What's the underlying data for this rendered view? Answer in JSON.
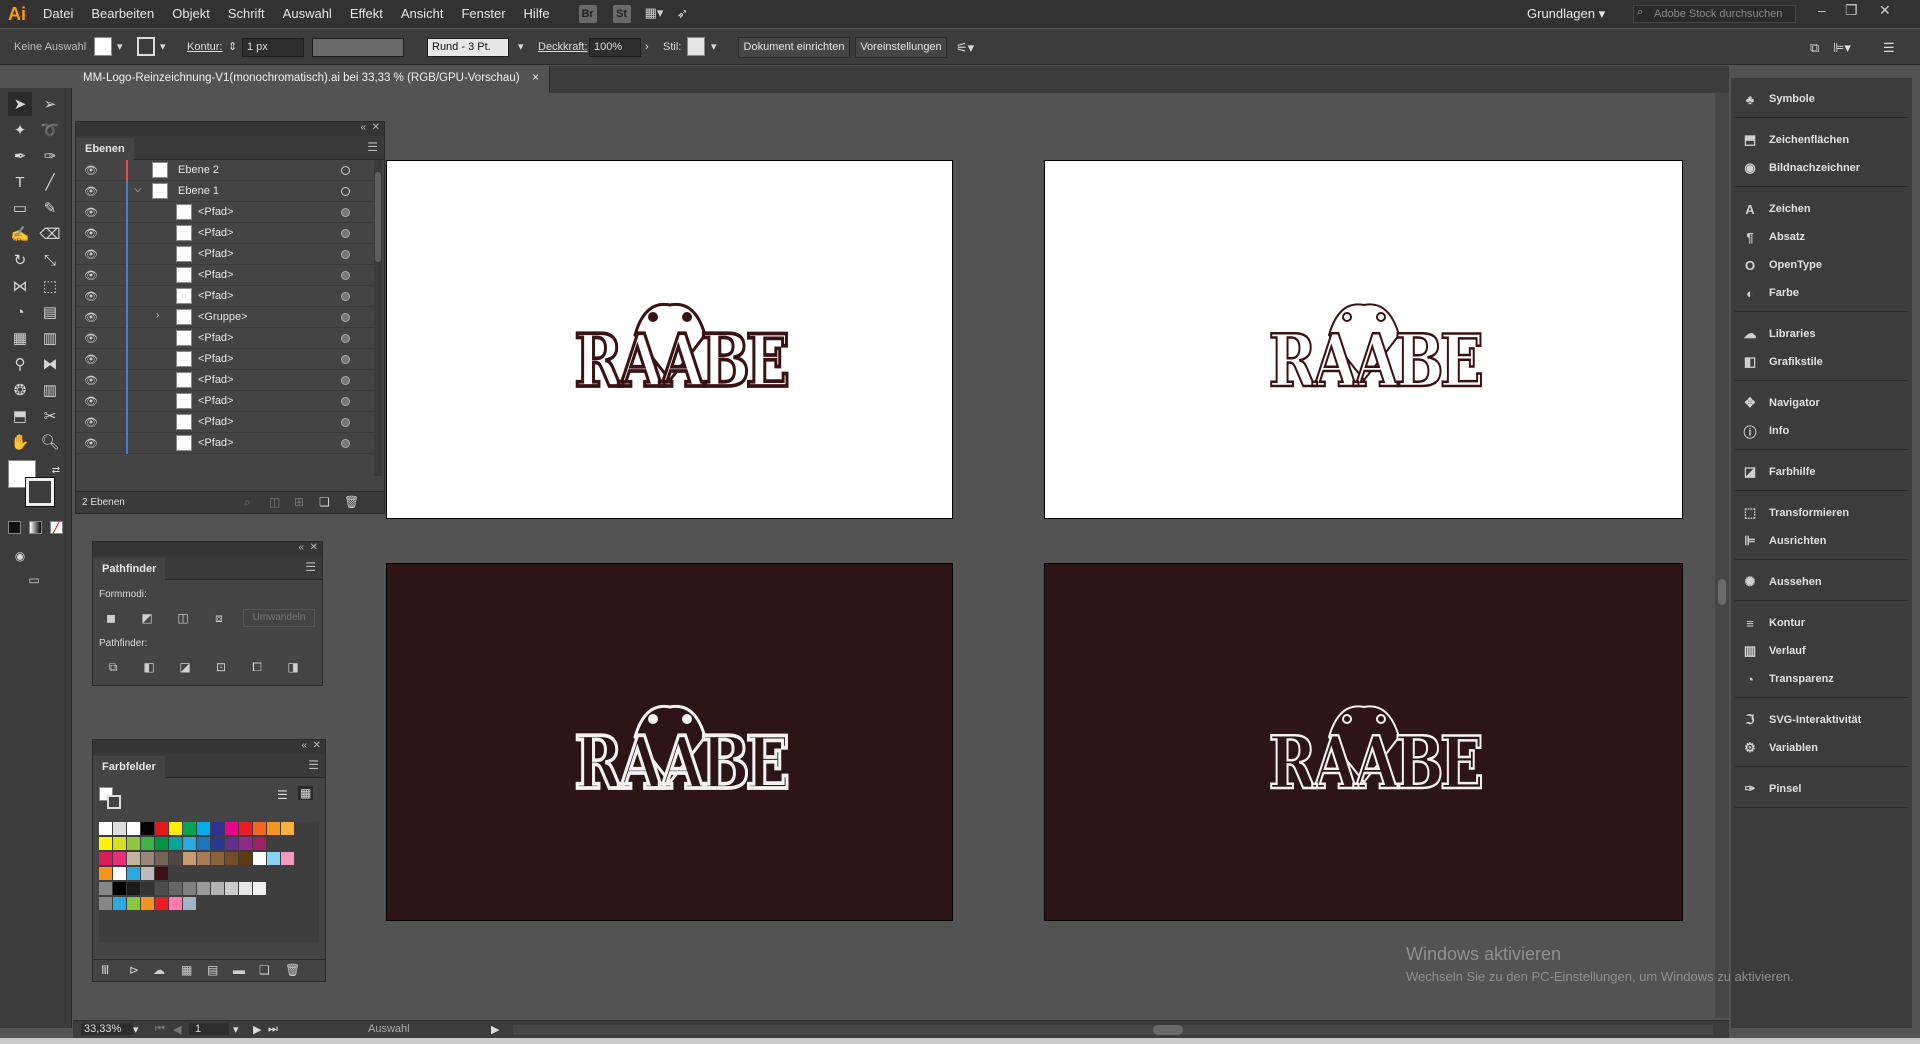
{
  "app": {
    "logo": "Ai"
  },
  "menu": [
    "Datei",
    "Bearbeiten",
    "Objekt",
    "Schrift",
    "Auswahl",
    "Effekt",
    "Ansicht",
    "Fenster",
    "Hilfe"
  ],
  "menubar_icons": {
    "bridge": "Br",
    "stock": "St"
  },
  "workspace": "Grundlagen",
  "stock_search_placeholder": "Adobe Stock durchsuchen",
  "controlbar": {
    "selection": "Keine Auswahl",
    "stroke_label": "Kontur:",
    "stroke_value": "1 px",
    "brush": "Rund - 3 Pt.",
    "opacity_label": "Deckkraft:",
    "opacity_value": "100%",
    "style_label": "Stil:",
    "document_setup": "Dokument einrichten",
    "preferences": "Voreinstellungen"
  },
  "document_tab": {
    "title": "MM-Logo-Reinzeichnung-V1(monochromatisch).ai bei 33,33 % (RGB/GPU-Vorschau)",
    "close": "×"
  },
  "artboards": [
    {
      "bg": "light",
      "logo": "RAABE"
    },
    {
      "bg": "light",
      "logo": "RAABE"
    },
    {
      "bg": "dark",
      "logo": "RAABE"
    },
    {
      "bg": "dark",
      "logo": "RAABE"
    }
  ],
  "layers_panel": {
    "tab": "Ebenen",
    "footer": "2 Ebenen",
    "rows": [
      {
        "name": "Ebene 2",
        "color": "#e8484c"
      },
      {
        "name": "Ebene 1",
        "color": "#3f7fd8"
      },
      {
        "name": "<Pfad>"
      },
      {
        "name": "<Pfad>"
      },
      {
        "name": "<Pfad>"
      },
      {
        "name": "<Pfad>"
      },
      {
        "name": "<Pfad>"
      },
      {
        "name": "<Gruppe>"
      },
      {
        "name": "<Pfad>"
      },
      {
        "name": "<Pfad>"
      },
      {
        "name": "<Pfad>"
      },
      {
        "name": "<Pfad>"
      },
      {
        "name": "<Pfad>"
      },
      {
        "name": "<Pfad>"
      }
    ]
  },
  "pathfinder_panel": {
    "tab": "Pathfinder",
    "shape_modes": "Formmodi:",
    "pathfinders": "Pathfinder:",
    "expand": "Umwandeln"
  },
  "swatches_panel": {
    "tab": "Farbfelder"
  },
  "right_panels": [
    {
      "label": "Symbole",
      "icon": "club-icon"
    },
    {
      "label": "Zeichenflächen",
      "icon": "artboard-icon"
    },
    {
      "label": "Bildnachzeichner",
      "icon": "trace-icon"
    },
    {
      "label": "Zeichen",
      "icon": "character-icon"
    },
    {
      "label": "Absatz",
      "icon": "paragraph-icon"
    },
    {
      "label": "OpenType",
      "icon": "opentype-icon"
    },
    {
      "label": "Farbe",
      "icon": "color-icon"
    },
    {
      "label": "Libraries",
      "icon": "libraries-icon"
    },
    {
      "label": "Grafikstile",
      "icon": "graphic-styles-icon"
    },
    {
      "label": "Navigator",
      "icon": "navigator-icon"
    },
    {
      "label": "Info",
      "icon": "info-icon"
    },
    {
      "label": "Farbhilfe",
      "icon": "color-guide-icon"
    },
    {
      "label": "Transformieren",
      "icon": "transform-icon"
    },
    {
      "label": "Ausrichten",
      "icon": "align-icon"
    },
    {
      "label": "Aussehen",
      "icon": "appearance-icon"
    },
    {
      "label": "Kontur",
      "icon": "stroke-icon"
    },
    {
      "label": "Verlauf",
      "icon": "gradient-icon"
    },
    {
      "label": "Transparenz",
      "icon": "transparency-icon"
    },
    {
      "label": "SVG-Interaktivität",
      "icon": "svg-icon"
    },
    {
      "label": "Variablen",
      "icon": "variables-icon"
    },
    {
      "label": "Pinsel",
      "icon": "brush-icon"
    }
  ],
  "statusbar": {
    "zoom": "33,33%",
    "artboard": "1",
    "tool": "Auswahl"
  },
  "watermark": {
    "title": "Windows aktivieren",
    "text": "Wechseln Sie zu den PC-Einstellungen, um Windows zu aktivieren."
  }
}
